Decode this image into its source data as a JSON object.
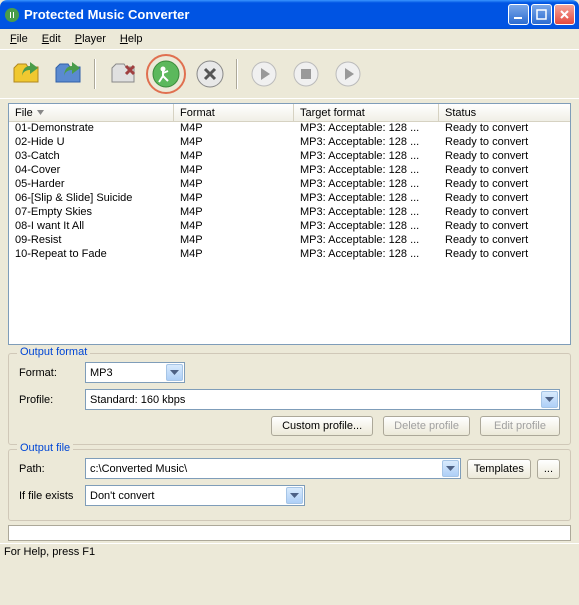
{
  "window": {
    "title": "Protected Music Converter"
  },
  "menu": {
    "file": "File",
    "edit": "Edit",
    "player": "Player",
    "help": "Help"
  },
  "toolbar": {
    "add_files": "add-files",
    "add_folder": "add-folder",
    "remove": "remove",
    "convert": "convert",
    "stop": "stop",
    "play": "play",
    "pause": "pause",
    "next": "next"
  },
  "columns": {
    "file": "File",
    "format": "Format",
    "target": "Target format",
    "status": "Status"
  },
  "files": [
    {
      "name": "01-Demonstrate",
      "format": "M4P",
      "target": "MP3: Acceptable: 128 ...",
      "status": "Ready to convert"
    },
    {
      "name": "02-Hide U",
      "format": "M4P",
      "target": "MP3: Acceptable: 128 ...",
      "status": "Ready to convert"
    },
    {
      "name": "03-Catch",
      "format": "M4P",
      "target": "MP3: Acceptable: 128 ...",
      "status": "Ready to convert"
    },
    {
      "name": "04-Cover",
      "format": "M4P",
      "target": "MP3: Acceptable: 128 ...",
      "status": "Ready to convert"
    },
    {
      "name": "05-Harder",
      "format": "M4P",
      "target": "MP3: Acceptable: 128 ...",
      "status": "Ready to convert"
    },
    {
      "name": "06-[Slip & Slide] Suicide",
      "format": "M4P",
      "target": "MP3: Acceptable: 128 ...",
      "status": "Ready to convert"
    },
    {
      "name": "07-Empty Skies",
      "format": "M4P",
      "target": "MP3: Acceptable: 128 ...",
      "status": "Ready to convert"
    },
    {
      "name": "08-I want It All",
      "format": "M4P",
      "target": "MP3: Acceptable: 128 ...",
      "status": "Ready to convert"
    },
    {
      "name": "09-Resist",
      "format": "M4P",
      "target": "MP3: Acceptable: 128 ...",
      "status": "Ready to convert"
    },
    {
      "name": "10-Repeat to Fade",
      "format": "M4P",
      "target": "MP3: Acceptable: 128 ...",
      "status": "Ready to convert"
    }
  ],
  "output_format": {
    "group_title": "Output format",
    "format_label": "Format:",
    "format_value": "MP3",
    "profile_label": "Profile:",
    "profile_value": "Standard: 160 kbps",
    "custom_btn": "Custom profile...",
    "delete_btn": "Delete profile",
    "edit_btn": "Edit profile"
  },
  "output_file": {
    "group_title": "Output file",
    "path_label": "Path:",
    "path_value": "c:\\Converted Music\\",
    "templates_btn": "Templates",
    "browse_btn": "...",
    "exists_label": "If file exists",
    "exists_value": "Don't convert"
  },
  "statusbar": {
    "text": "For Help, press F1"
  }
}
